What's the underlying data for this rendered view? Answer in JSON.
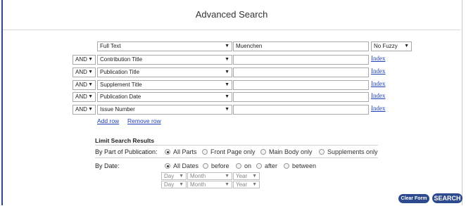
{
  "title": "Advanced Search",
  "first_row": {
    "field": "Full Text",
    "value": "Muenchen",
    "fuzzy": "No Fuzzy"
  },
  "rows": [
    {
      "op": "AND",
      "field": "Contribution Title",
      "link": "Index"
    },
    {
      "op": "AND",
      "field": "Publication Title",
      "link": "Index"
    },
    {
      "op": "AND",
      "field": "Supplement Title",
      "link": "Index"
    },
    {
      "op": "AND",
      "field": "Publication Date",
      "link": "Index"
    },
    {
      "op": "AND",
      "field": "Issue Number",
      "link": "Index"
    }
  ],
  "add_row": "Add row",
  "remove_row": "Remove row",
  "limit": {
    "heading": "Limit Search Results",
    "by_part_label": "By Part of Publication:",
    "parts": [
      "All Parts",
      "Front Page only",
      "Main Body only",
      "Supplements only"
    ],
    "part_selected": "All Parts",
    "by_date_label": "By Date:",
    "dates": [
      "All Dates",
      "before",
      "on",
      "after",
      "between"
    ],
    "date_selected": "All Dates",
    "day": "Day",
    "month": "Month",
    "year": "Year"
  },
  "buttons": {
    "clear": "Clear Form",
    "search": "SEARCH"
  },
  "colors": {
    "link": "#1f3fb5",
    "button": "#2d4a8e",
    "frame": "#2b4a8a"
  }
}
